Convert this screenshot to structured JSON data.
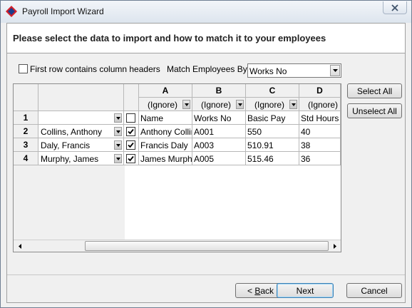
{
  "window": {
    "title": "Payroll Import Wizard"
  },
  "header": {
    "heading": "Please select the data to import and how to match it to your employees"
  },
  "options": {
    "first_row_headers_label": "First row contains column headers",
    "first_row_headers_checked": false,
    "match_by_label": "Match Employees By",
    "match_by_value": "Works No"
  },
  "grid": {
    "columns": [
      {
        "letter": "A",
        "mapping": "(Ignore)"
      },
      {
        "letter": "B",
        "mapping": "(Ignore)"
      },
      {
        "letter": "C",
        "mapping": "(Ignore)"
      },
      {
        "letter": "D",
        "mapping": "(Ignore)"
      }
    ],
    "rows": [
      {
        "num": "1",
        "employee": "",
        "checked": false,
        "cells": [
          "Name",
          "Works No",
          "Basic Pay",
          "Std Hours"
        ]
      },
      {
        "num": "2",
        "employee": "Collins, Anthony",
        "checked": true,
        "cells": [
          "Anthony Collins",
          "A001",
          "550",
          "40"
        ]
      },
      {
        "num": "3",
        "employee": "Daly, Francis",
        "checked": true,
        "cells": [
          "Francis Daly",
          "A003",
          "510.91",
          "38"
        ]
      },
      {
        "num": "4",
        "employee": "Murphy, James",
        "checked": true,
        "cells": [
          "James Murphy",
          "A005",
          "515.46",
          "36"
        ]
      }
    ]
  },
  "buttons": {
    "select_all": "Select All",
    "unselect_all": "Unselect All",
    "back_prefix": "< ",
    "back_accel": "B",
    "back_rest": "ack",
    "next": "Next",
    "cancel": "Cancel"
  }
}
